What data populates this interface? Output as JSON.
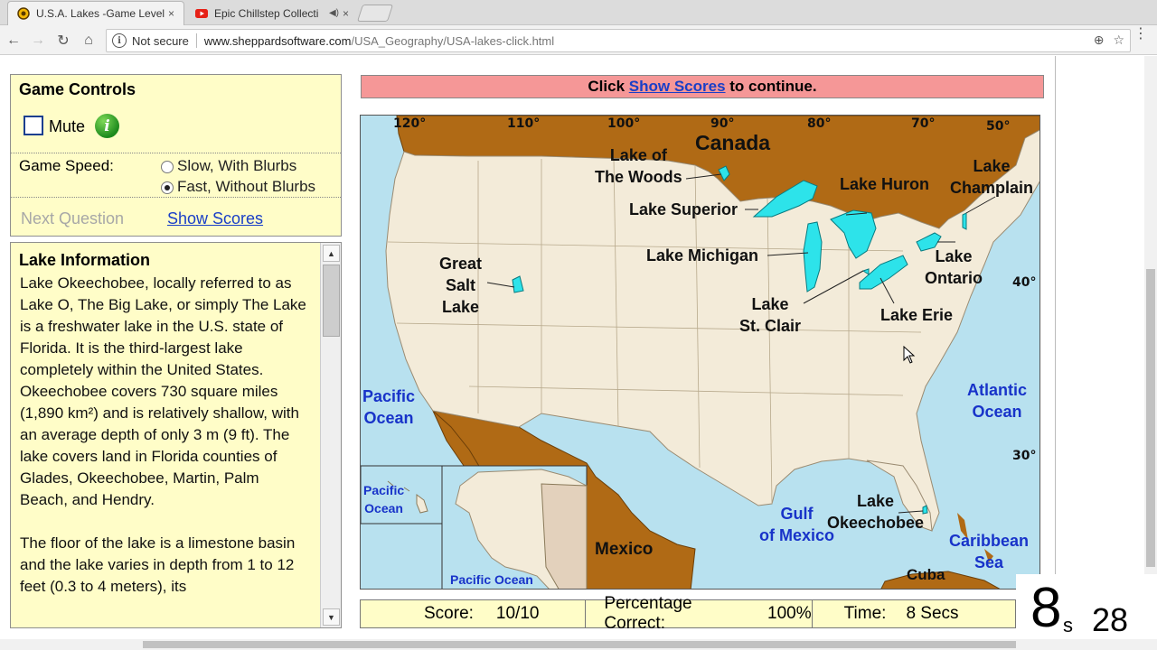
{
  "browser": {
    "tabs": [
      {
        "title": "U.S.A. Lakes -Game Level",
        "favicon": "sheppard-icon",
        "close": "×"
      },
      {
        "title": "Epic Chillstep Collecti",
        "favicon": "youtube-icon",
        "audio": "◀)",
        "close": "×"
      }
    ],
    "nav": {
      "back": "←",
      "forward": "→",
      "reload": "↻",
      "home": "⌂"
    },
    "address": {
      "security_label": "Not secure",
      "host": "www.sheppardsoftware.com",
      "path": "/USA_Geography/USA-lakes-click.html"
    },
    "icons": {
      "zoom": "⊕",
      "star": "☆",
      "menu": "⋮"
    }
  },
  "game_controls": {
    "title": "Game Controls",
    "mute_label": "Mute",
    "mute_checked": false,
    "info_icon_text": "i",
    "speed_label": "Game Speed:",
    "speed_options": [
      "Slow, With Blurbs",
      "Fast, Without Blurbs"
    ],
    "speed_selected": "Fast, Without Blurbs",
    "next_question": "Next Question",
    "show_scores": "Show Scores"
  },
  "lake_info": {
    "title": "Lake Information",
    "paragraphs": [
      "Lake Okeechobee, locally referred to as Lake O, The Big Lake, or simply The Lake is a freshwater lake in the U.S. state of Florida. It is the third-largest lake completely within the United States. Okeechobee covers 730 square miles (1,890 km²) and is relatively shallow, with an average depth of only 3 m (9 ft). The lake covers land in Florida counties of Glades, Okeechobee, Martin, Palm Beach, and Hendry.",
      "The floor of the lake is a limestone basin and the lake varies in depth from 1 to 12 feet (0.3 to 4 meters), its"
    ]
  },
  "banner": {
    "before": "Click ",
    "link": "Show Scores",
    "after": " to continue."
  },
  "map": {
    "countries": {
      "canada": "Canada",
      "mexico": "Mexico",
      "cuba": "Cuba"
    },
    "waters": {
      "pacific": "Pacific Ocean",
      "pacific_line1": "Pacific",
      "pacific_line2": "Ocean",
      "atlantic_line1": "Atlantic",
      "atlantic_line2": "Ocean",
      "gulf_line1": "Gulf",
      "gulf_line2": "of Mexico",
      "caribbean_line1": "Caribbean",
      "caribbean_line2": "Sea",
      "inset_pacific": "Pacific Ocean",
      "hawaii_line1": "Pacific",
      "hawaii_line2": "Ocean"
    },
    "lakes": {
      "woods_line1": "Lake of",
      "woods_line2": "The Woods",
      "superior": "Lake Superior",
      "huron": "Lake Huron",
      "champlain_line1": "Lake",
      "champlain_line2": "Champlain",
      "michigan": "Lake Michigan",
      "ontario_line1": "Lake",
      "ontario_line2": "Ontario",
      "gsl_line1": "Great",
      "gsl_line2": "Salt",
      "gsl_line3": "Lake",
      "stclair_line1": "Lake",
      "stclair_line2": "St. Clair",
      "erie": "Lake Erie",
      "okeechobee_line1": "Lake",
      "okeechobee_line2": "Okeechobee"
    },
    "longitudes": [
      "120°",
      "110°",
      "100°",
      "90°",
      "80°",
      "70°",
      "50°"
    ],
    "latitudes": [
      "40°",
      "30°"
    ]
  },
  "scores": {
    "score_label": "Score:",
    "score_value": "10/10",
    "pct_label": "Percentage Correct:",
    "pct_value": "100%",
    "time_label": "Time:",
    "time_value": "8 Secs"
  },
  "timer_overlay": {
    "big": "8",
    "unit": "s",
    "small": "28"
  },
  "colors": {
    "panel_bg": "#fffdc8",
    "banner_bg": "#f59797",
    "link": "#1a3fc7",
    "land_foreign": "#b06a15",
    "water": "#b8e1ef",
    "lake": "#2de3ea"
  }
}
